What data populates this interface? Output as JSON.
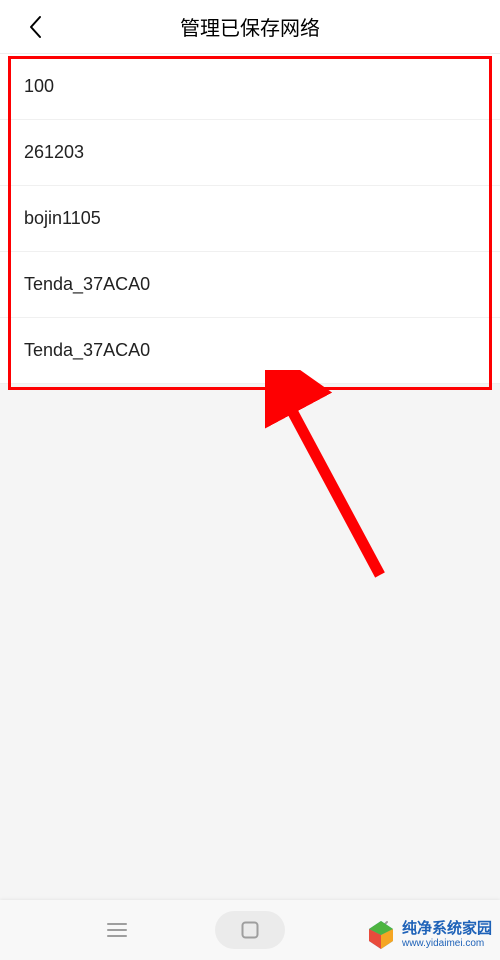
{
  "header": {
    "title": "管理已保存网络"
  },
  "networks": {
    "items": [
      {
        "name": "100"
      },
      {
        "name": "261203"
      },
      {
        "name": "bojin1105"
      },
      {
        "name": "Tenda_37ACA0"
      },
      {
        "name": "Tenda_37ACA0"
      }
    ]
  },
  "watermark": {
    "text": "纯净系统家园",
    "url": "www.yidaimei.com"
  },
  "annotation": {
    "highlight_color": "#fe0002",
    "arrow_color": "#fe0002"
  }
}
